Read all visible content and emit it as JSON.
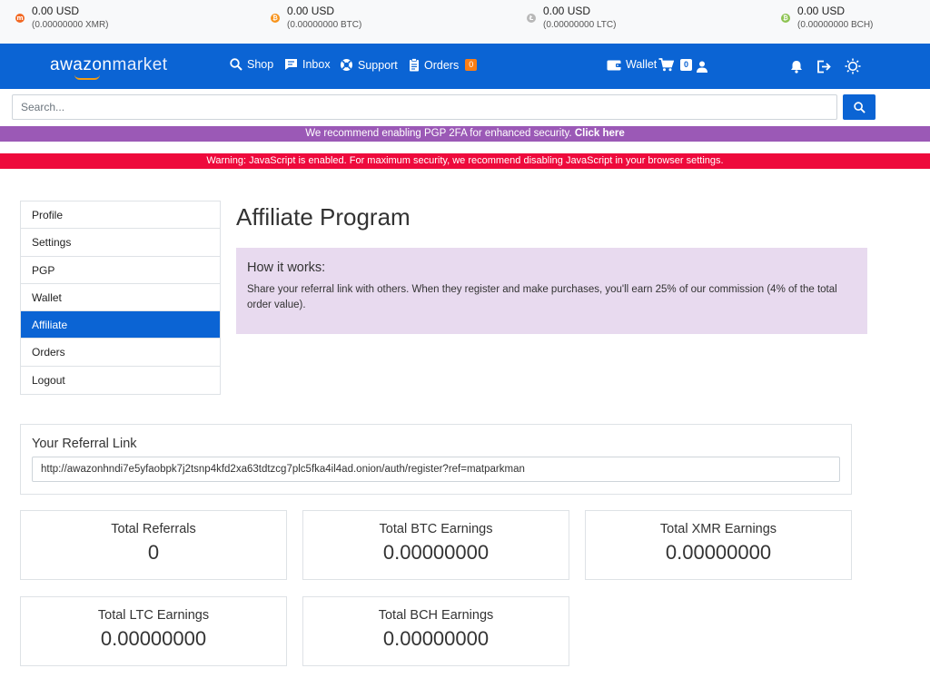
{
  "ticker": [
    {
      "usd": "0.00 USD",
      "crypto": "(0.00000000 XMR)",
      "icon": "monero-icon",
      "color": "#f26822",
      "glyph": "m"
    },
    {
      "usd": "0.00 USD",
      "crypto": "(0.00000000 BTC)",
      "icon": "bitcoin-icon",
      "color": "#f7931a",
      "glyph": "₿"
    },
    {
      "usd": "0.00 USD",
      "crypto": "(0.00000000 LTC)",
      "icon": "litecoin-icon",
      "color": "#b8b8b8",
      "glyph": "Ł"
    },
    {
      "usd": "0.00 USD",
      "crypto": "(0.00000000 BCH)",
      "icon": "bitcoin-cash-icon",
      "color": "#8dc351",
      "glyph": "₿"
    }
  ],
  "nav": {
    "brand_part1": "awazon",
    "brand_part2": "market",
    "shop": "Shop",
    "inbox": "Inbox",
    "support": "Support",
    "orders": "Orders",
    "orders_count": "0",
    "wallet": "Wallet",
    "cart_count": "0"
  },
  "search": {
    "placeholder": "Search..."
  },
  "alerts": {
    "pgp_text": "We recommend enabling PGP 2FA for enhanced security.",
    "pgp_link": "Click here",
    "js_warning": "Warning: JavaScript is enabled. For maximum security, we recommend disabling JavaScript in your browser settings."
  },
  "sidebar": {
    "items": [
      {
        "label": "Profile"
      },
      {
        "label": "Settings"
      },
      {
        "label": "PGP"
      },
      {
        "label": "Wallet"
      },
      {
        "label": "Affiliate"
      },
      {
        "label": "Orders"
      },
      {
        "label": "Logout"
      }
    ]
  },
  "main": {
    "title": "Affiliate Program",
    "how_title": "How it works:",
    "how_text": "Share your referral link with others. When they register and make purchases, you'll earn 25% of our commission (4% of the total order value).",
    "ref_title": "Your Referral Link",
    "ref_link": "http://awazonhndi7e5yfaobpk7j2tsnp4kfd2xa63tdtzcg7plc5fka4il4ad.onion/auth/register?ref=matparkman",
    "stats": [
      {
        "label": "Total Referrals",
        "value": "0"
      },
      {
        "label": "Total BTC Earnings",
        "value": "0.00000000"
      },
      {
        "label": "Total XMR Earnings",
        "value": "0.00000000"
      },
      {
        "label": "Total LTC Earnings",
        "value": "0.00000000"
      },
      {
        "label": "Total BCH Earnings",
        "value": "0.00000000"
      }
    ]
  },
  "colors": {
    "primary": "#0b64d4",
    "pgp_alert": "#9b59b6",
    "js_alert": "#ee0a3c",
    "info_bg": "#e8daef"
  }
}
